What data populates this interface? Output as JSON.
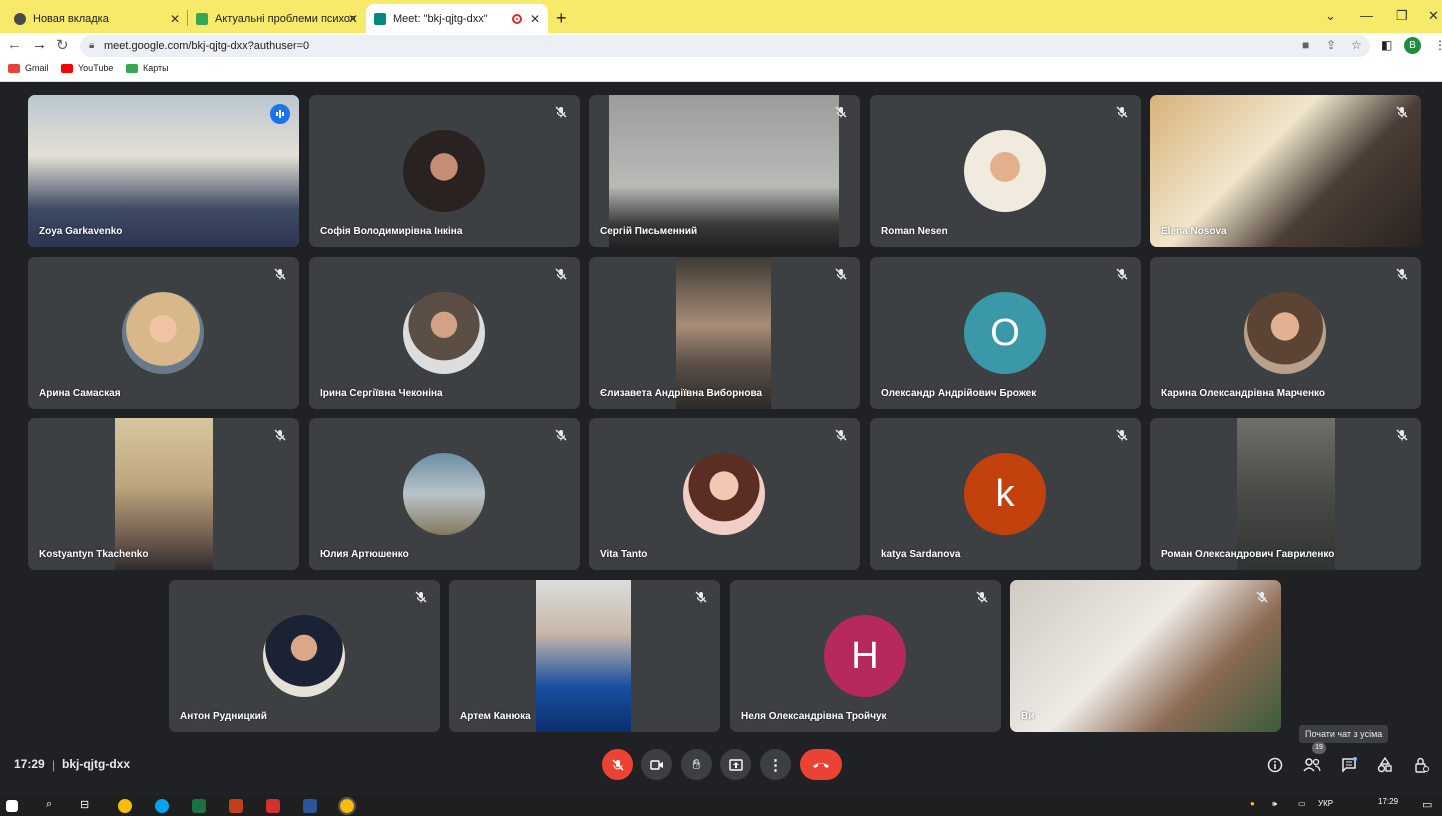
{
  "browser": {
    "tabs": [
      {
        "title": "Новая вкладка",
        "active": false,
        "color": "#4a4a4a"
      },
      {
        "title": "Актуальні проблеми психології",
        "active": false,
        "color": "#34a853"
      },
      {
        "title": "Meet: \"bkj-qjtg-dxx\"",
        "active": true,
        "color": "#00897b"
      }
    ],
    "url": "meet.google.com/bkj-qjtg-dxx?authuser=0",
    "profile_initial": "B",
    "bookmarks": [
      "Gmail",
      "YouTube",
      "Карты"
    ]
  },
  "meeting": {
    "time": "17:29",
    "code": "bkj-qjtg-dxx",
    "participants_count": "19",
    "tooltip": "Почати чат з усіма",
    "colors": {
      "speaking_border": "#8ab4f8",
      "end_call": "#ea4335",
      "tile_bg": "#3c4043"
    }
  },
  "participants": [
    {
      "name": "Zoya Garkavenko",
      "type": "video",
      "speaking": true
    },
    {
      "name": "Софія Володимирівна Інкіна",
      "type": "avatar"
    },
    {
      "name": "Сергій Письменний",
      "type": "video"
    },
    {
      "name": "Roman Nesen",
      "type": "avatar"
    },
    {
      "name": "Elena Nosova",
      "type": "video"
    },
    {
      "name": "Арина Самаская",
      "type": "avatar"
    },
    {
      "name": "Ірина Сергіївна Чеконіна",
      "type": "avatar"
    },
    {
      "name": "Єлизавета Андріївна Виборнова",
      "type": "video"
    },
    {
      "name": "Олександр Андрійович Брожек",
      "type": "letter",
      "letter": "O",
      "color": "#3a98a8"
    },
    {
      "name": "Карина Олександрівна Марченко",
      "type": "avatar"
    },
    {
      "name": "Kostyantyn Tkachenko",
      "type": "video"
    },
    {
      "name": "Юлия Артюшенко",
      "type": "avatar"
    },
    {
      "name": "Vita Tanto",
      "type": "avatar"
    },
    {
      "name": "katya Sardanova",
      "type": "letter",
      "letter": "k",
      "color": "#c2410c"
    },
    {
      "name": "Роман Олександрович Гавриленко",
      "type": "video"
    },
    {
      "name": "Антон Рудницкий",
      "type": "avatar"
    },
    {
      "name": "Артем Канюка",
      "type": "video"
    },
    {
      "name": "Неля Олександрівна Тройчук",
      "type": "letter",
      "letter": "H",
      "color": "#b5295c"
    },
    {
      "name": "Ви",
      "type": "video"
    }
  ],
  "taskbar": {
    "lang": "УКР",
    "time": "17:29"
  }
}
